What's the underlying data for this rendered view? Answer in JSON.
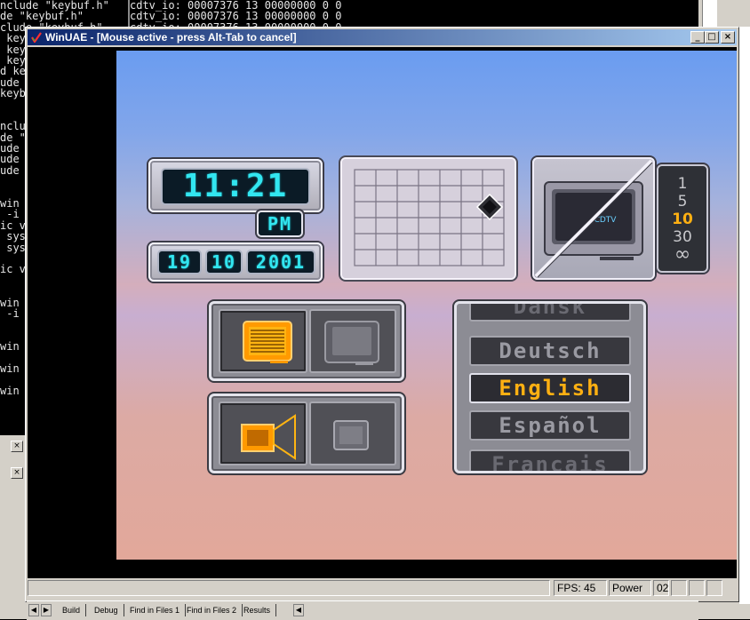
{
  "background": {
    "code_lines": [
      "nclude \"keybuf.h\"",
      "de \"keybuf.h\"",
      "clude \"keybuf.h\"",
      " key",
      " key",
      " key",
      "d ke",
      "ude",
      "keyb",
      "",
      "",
      "nclu",
      "de \"",
      "ude",
      "ude",
      "ude",
      "",
      "",
      "win",
      " -i",
      "ic v",
      " sys",
      " sys",
      "",
      "ic v",
      "",
      "",
      "win",
      " -i",
      "",
      "",
      "win",
      "",
      "win",
      "",
      "win"
    ],
    "output_lines": [
      "cdtv_io: 00007376 13 00000000 0 0",
      "cdtv_io: 00007376 13 00000000 0 0",
      "cdtv_io: 00007376 13 00000000 0 0"
    ],
    "taskbar_tabs": [
      "Build",
      "Debug",
      "Find in Files 1",
      "Find in Files 2",
      "Results"
    ]
  },
  "window": {
    "title": "WinUAE - [Mouse active - press Alt-Tab to cancel]",
    "minimize_glyph": "_",
    "maximize_glyph": "□",
    "close_glyph": "×"
  },
  "cdtv": {
    "clock_time": "11:21",
    "ampm": "PM",
    "date_day": "19",
    "date_month": "10",
    "date_year": "2001",
    "tv_label": "CDTV",
    "speed_options": [
      "1",
      "5",
      "10",
      "30",
      "∞"
    ],
    "speed_selected": "10",
    "languages": [
      "Dansk",
      "Deutsch",
      "English",
      "Español",
      "Français"
    ],
    "language_selected": "English"
  },
  "status": {
    "fps": "FPS: 45",
    "power": "Power",
    "drive": "02"
  },
  "colors": {
    "lcd": "#32e6f0",
    "accent": "#ffb012",
    "title_start": "#0a246a",
    "title_end": "#a6caf0"
  }
}
